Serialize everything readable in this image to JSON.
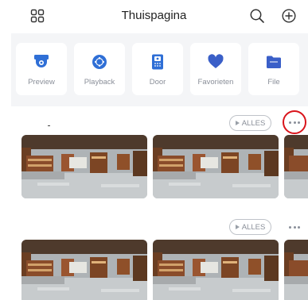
{
  "header": {
    "title": "Thuispagina",
    "left_icon": "grid-icon",
    "right_icons": [
      "search-icon",
      "add-icon"
    ]
  },
  "shortcuts": [
    {
      "label": "Preview",
      "icon": "camera-icon",
      "color": "#2f6fd6"
    },
    {
      "label": "Playback",
      "icon": "playback-icon",
      "color": "#2f6fd6"
    },
    {
      "label": "Door",
      "icon": "door-intercom-icon",
      "color": "#2f6fd6"
    },
    {
      "label": "Favorieten",
      "icon": "heart-icon",
      "color": "#3a5fc8"
    },
    {
      "label": "File",
      "icon": "folder-icon",
      "color": "#3a5fc8"
    }
  ],
  "groups": [
    {
      "alles_label": "ALLES",
      "more_label": "more-options",
      "highlighted": true
    },
    {
      "alles_label": "ALLES",
      "more_label": "more-options",
      "highlighted": false
    }
  ],
  "colors": {
    "accent": "#2f6fd6",
    "highlight": "#d9141b",
    "panel_bg": "#f4f5f7"
  }
}
